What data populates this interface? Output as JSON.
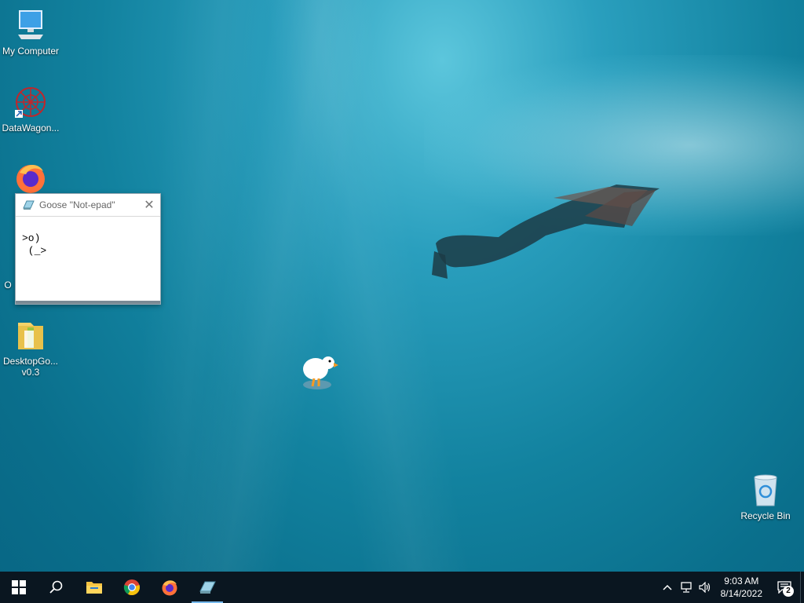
{
  "desktop": {
    "icons": [
      {
        "label": "My Computer",
        "icon": "computer-icon"
      },
      {
        "label": "DataWagon...",
        "icon": "datawagon-icon"
      },
      {
        "label": "",
        "icon": "firefox-icon"
      },
      {
        "label": "O",
        "icon": "partial-icon"
      },
      {
        "label": "DesktopGo...\nv0.3",
        "icon": "folder-zip-icon"
      },
      {
        "label": "Recycle Bin",
        "icon": "recycle-bin-icon"
      }
    ]
  },
  "notepad": {
    "title": "Goose \"Not-epad\"",
    "text": ">o)\n (_>",
    "close_glyph": "✕"
  },
  "taskbar": {
    "apps": [
      "start-icon",
      "search-icon",
      "file-explorer-icon",
      "chrome-icon",
      "firefox-icon",
      "notepad-icon"
    ],
    "clock_time": "9:03 AM",
    "clock_date": "8/14/2022",
    "notifications_count": "2"
  },
  "colors": {
    "taskbar_bg": "#0a1620",
    "accent": "#76b9ed"
  }
}
